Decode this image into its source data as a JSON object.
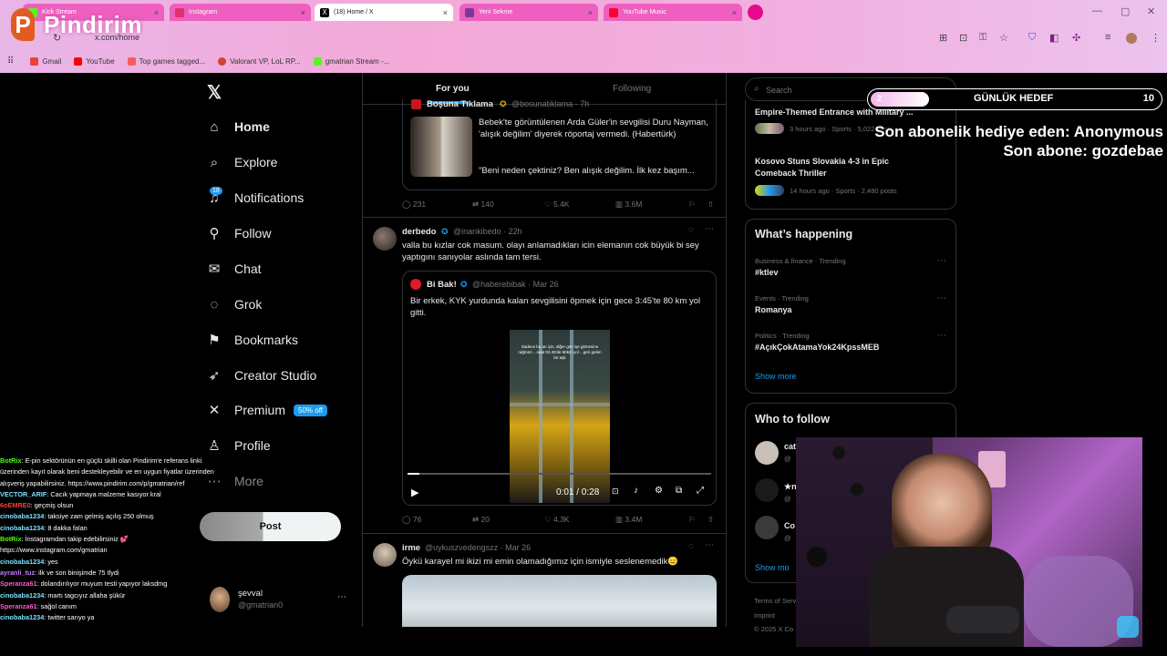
{
  "browser": {
    "tabs": [
      {
        "label": "Kick Stream",
        "color": "#53fc18"
      },
      {
        "label": "Instagram",
        "color": "#e1306c"
      },
      {
        "label": "(18) Home / X",
        "color": "#000000"
      },
      {
        "label": "Yeni Sekme",
        "color": "#7b3a9a"
      },
      {
        "label": "YouTube Music",
        "color": "#ff0033"
      }
    ],
    "url": "x.com/home",
    "bookmarks": [
      {
        "label": "Gmail",
        "color": "#ea4335"
      },
      {
        "label": "YouTube",
        "color": "#ff0000"
      },
      {
        "label": "Top games tagged...",
        "color": "#fa5c5c"
      },
      {
        "label": "Valorant VP, LoL RP...",
        "color": "#d9412b"
      },
      {
        "label": "gmatrian Stream -...",
        "color": "#53fc18"
      }
    ]
  },
  "overlay": {
    "brand": "Pindirim",
    "goal_label": "GÜNLÜK HEDEF",
    "goal_current": "2",
    "goal_target": "10",
    "goal_progress": 0.2,
    "last_gift": "Son abonelik hediye eden: Anonymous",
    "last_sub": "Son abone: gozdebae"
  },
  "sidebar": {
    "items": [
      {
        "label": "Home",
        "icon": "home-icon",
        "glyph": "⌂"
      },
      {
        "label": "Explore",
        "icon": "search-icon",
        "glyph": "⌕"
      },
      {
        "label": "Notifications",
        "icon": "bell-icon",
        "glyph": "♫"
      },
      {
        "label": "Follow",
        "icon": "follow-icon",
        "glyph": "⚲"
      },
      {
        "label": "Chat",
        "icon": "mail-icon",
        "glyph": "✉"
      },
      {
        "label": "Grok",
        "icon": "grok-icon",
        "glyph": "◌"
      },
      {
        "label": "Bookmarks",
        "icon": "bookmark-icon",
        "glyph": "⚑"
      },
      {
        "label": "Creator Studio",
        "icon": "rocket-icon",
        "glyph": "➶"
      },
      {
        "label": "Premium",
        "icon": "x-icon",
        "glyph": "✕"
      },
      {
        "label": "Profile",
        "icon": "profile-icon",
        "glyph": "♙"
      },
      {
        "label": "More",
        "icon": "more-icon",
        "glyph": "⋯"
      }
    ],
    "notif_count": "18",
    "premium_badge": "50% off",
    "post_label": "Post",
    "account_name": "şevval",
    "account_handle": "@gmatrian0"
  },
  "feed": {
    "tabs": [
      "For you",
      "Following"
    ],
    "tweets": [
      {
        "quote_name": "Boşuna Tıklama",
        "quote_handle": "@bosunatiklama · 7h",
        "quote_text": "Bebek'te görüntülenen Arda Güler'in sevgilisi Duru Nayman, 'alışık değilim' diyerek röportaj vermedi. (Habertürk)",
        "quote_text2": "\"Beni neden çektiniz? Ben alışık değilim. İlk kez başım...",
        "replies": "231",
        "reposts": "140",
        "likes": "5.4K",
        "views": "3.6M"
      },
      {
        "name": "derbedo",
        "handle": "@inankibedo · 22h",
        "text": "valla bu kızlar cok masum. olayı anlamadıkları icin elemanın cok büyük bi sey yaptıgını sanıyolar aslında tam tersi.",
        "quote_name": "Bi Bak!",
        "quote_handle": "@haberebibak · Mar 26",
        "quote_text": "Bir erkek, KYK yurdunda kalan sevgilisini öpmek için gece 3:45'te 80 km yol gitti.",
        "video_caption": "Sadece bu an için, diğer gün işe gitmesine rağmen ...saat 03.45'de 80km yol ...geri gelen bir aşk",
        "video_time": "0:01 / 0:28",
        "video_progress": 0.04,
        "replies": "76",
        "reposts": "20",
        "likes": "4.3K",
        "views": "3.4M"
      },
      {
        "name": "irme",
        "handle": "@uykuszvedengszz · Mar 26",
        "text": "Öykü karayel mi ikizi mi emin olamadığımız için ismiyle seslenemedik😑"
      }
    ]
  },
  "right": {
    "search_placeholder": "Search",
    "news": [
      {
        "title": "Empire-Themed Entrance with Military ...",
        "meta": "3 hours ago · Sports · 5,022 posts"
      },
      {
        "title": "Kosovo Stuns Slovakia 4-3 in Epic Comeback Thriller",
        "meta": "14 hours ago · Sports · 2,480 posts"
      }
    ],
    "happening_title": "What’s happening",
    "trends": [
      {
        "meta": "Business & finance · Trending",
        "title": "#ktlev"
      },
      {
        "meta": "Events · Trending",
        "title": "Romanya"
      },
      {
        "meta": "Politics · Trending",
        "title": "#AçıkÇokAtamaYok24KpssMEB"
      }
    ],
    "show_more": "Show more",
    "follow_title": "Who to follow",
    "follow": [
      {
        "name": "cat",
        "handle": "@"
      },
      {
        "name": "★n",
        "handle": "@"
      },
      {
        "name": "Co",
        "handle": "@"
      }
    ],
    "show_more_2": "Show mo",
    "footer_1": "Terms of Serv",
    "footer_2": "Imprint",
    "footer_3": "© 2025 X Co"
  },
  "chat": [
    {
      "name": "BotRix",
      "color": "#53fc18",
      "text": ": E-pin sektörünün en güçlü skilli olan Pindirim'e referans linki üzerinden kayıt olarak beni destekleyebilir ve en uygun fiyatlar üzerinden alışveriş yapabilirsiniz. https://www.pindirim.com/p/gmatrian/ref"
    },
    {
      "name": "VECTOR_ARIF",
      "color": "#7ce0ff",
      "text": ": Cacık yapmaya malzeme kasıyor kral"
    },
    {
      "name": "6oEMRE0",
      "color": "#ff3b3b",
      "text": ": geçmiş olsun"
    },
    {
      "name": "cinobaba1234",
      "color": "#7ce0ff",
      "text": ": taksiye zam gelmiş açılış 250 olmuş"
    },
    {
      "name": "cinobaba1234",
      "color": "#7ce0ff",
      "text": ": 8 dakka falan"
    },
    {
      "name": "BotRix",
      "color": "#53fc18",
      "text": ": İnstagramdan takip edebilirsiniz 💕 https://www.instagram.com/gmatrian"
    },
    {
      "name": "cinobaba1234",
      "color": "#7ce0ff",
      "text": ": yes"
    },
    {
      "name": "ayranli_tuz",
      "color": "#c77dff",
      "text": ": ilk ve son binişimde 75 tlydi"
    },
    {
      "name": "Speranza61",
      "color": "#ff5ac8",
      "text": ": dolandırılıyor muyum testi yapıyor laksdmg"
    },
    {
      "name": "cinobaba1234",
      "color": "#7ce0ff",
      "text": ": martı tagcıyız allaha şükür"
    },
    {
      "name": "Speranza61",
      "color": "#ff5ac8",
      "text": ": sağol canım"
    },
    {
      "name": "cinobaba1234",
      "color": "#7ce0ff",
      "text": ": twitter sarıyo ya"
    }
  ],
  "colors": {
    "accent": "#1d9bf0",
    "brand": "#e25c21",
    "kick": "#53fc18"
  }
}
